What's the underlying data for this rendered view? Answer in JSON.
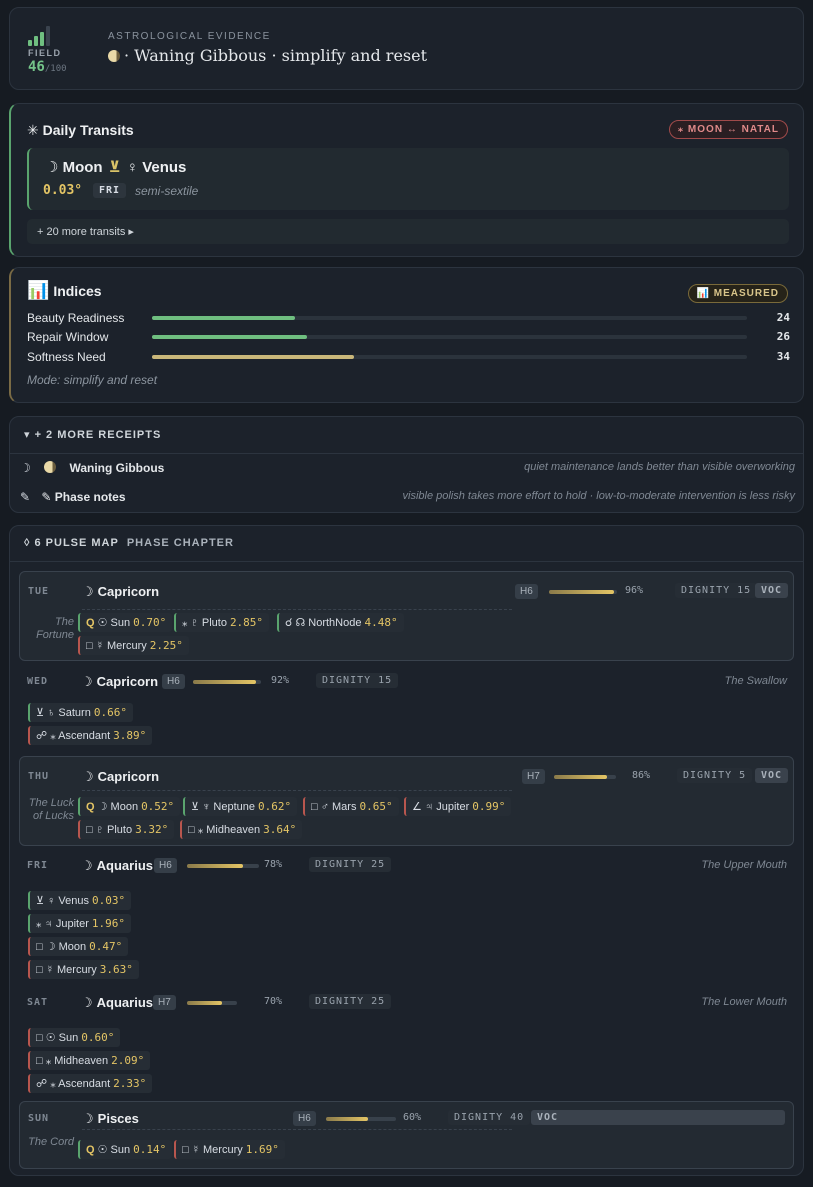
{
  "header": {
    "field_label": "FIELD",
    "field_value": "46",
    "field_max": "/100",
    "evidence_label": "ASTROLOGICAL EVIDENCE",
    "evidence_title": "· Waning Gibbous · simplify and reset"
  },
  "transits": {
    "title": "Daily Transits",
    "badge": "⁎ MOON ↔ NATAL",
    "main": {
      "body1": "☽ Moon",
      "aspect": "⊻",
      "body2": "♀ Venus",
      "orb": "0.03°",
      "day": "FRI",
      "desc": "semi-sextile"
    },
    "more": "+ 20 more transits ▸"
  },
  "indices": {
    "title": "Indices",
    "badge": "📊 MEASURED",
    "items": [
      {
        "label": "Beauty Readiness",
        "value": 24,
        "color": "#6fbf80"
      },
      {
        "label": "Repair Window",
        "value": 26,
        "color": "#6fbf80"
      },
      {
        "label": "Softness Need",
        "value": 34,
        "color": "#c9b77a"
      }
    ],
    "mode": "Mode: simplify and reset"
  },
  "receipts": {
    "title": "▾ + 2 MORE RECEIPTS",
    "rows": [
      {
        "icon": "☽",
        "label": "Waning Gibbous",
        "note": "quiet maintenance lands better than visible overworking"
      },
      {
        "icon": "✎",
        "label": "✎ Phase notes",
        "note": "visible polish takes more effort to hold · low-to-moderate intervention is less risky"
      }
    ]
  },
  "pulse": {
    "title": "◊ 6 PULSE MAP",
    "subtitle": "PHASE CHAPTER",
    "days": [
      {
        "day": "TUE",
        "sign": "Capricorn",
        "house": "H6",
        "pct": 96,
        "pct_label": "96%",
        "dignity": "DIGNITY 15",
        "voc": "VOC",
        "chapter": "The Fortune",
        "tags": [
          {
            "q": "Q",
            "text": "☉ Sun",
            "orb": "0.70°"
          },
          {
            "text": "⁎ ♇ Pluto",
            "orb": "2.85°"
          },
          {
            "text": "☌ ☊ NorthNode",
            "orb": "4.48°"
          },
          {
            "text": "□ ☿ Mercury",
            "orb": "2.25°"
          }
        ]
      },
      {
        "day": "WED",
        "sign": "Capricorn",
        "house": "H6",
        "pct": 92,
        "pct_label": "92%",
        "dignity": "DIGNITY 15",
        "chapter": "The Swallow",
        "tags": [
          {
            "text": "⊻ ♄ Saturn",
            "orb": "0.66°"
          },
          {
            "text": "☍ ⁎ Ascendant",
            "orb": "3.89°"
          }
        ]
      },
      {
        "day": "THU",
        "sign": "Capricorn",
        "house": "H7",
        "pct": 86,
        "pct_label": "86%",
        "dignity": "DIGNITY 5",
        "voc": "VOC",
        "chapter": "The Luck of Lucks",
        "tags": [
          {
            "q": "Q",
            "text": "☽ Moon",
            "orb": "0.52°"
          },
          {
            "text": "⊻ ♆ Neptune",
            "orb": "0.62°"
          },
          {
            "text": "□ ♂ Mars",
            "orb": "0.65°"
          },
          {
            "text": "∠ ♃ Jupiter",
            "orb": "0.99°"
          },
          {
            "text": "□ ♇ Pluto",
            "orb": "3.32°"
          },
          {
            "text": "□ ⁎ Midheaven",
            "orb": "3.64°"
          }
        ]
      },
      {
        "day": "FRI",
        "sign": "Aquarius",
        "house": "H6",
        "pct": 78,
        "pct_label": "78%",
        "dignity": "DIGNITY 25",
        "chapter": "The Upper Mouth",
        "tags": [
          {
            "text": "⊻ ♀ Venus",
            "orb": "0.03°"
          },
          {
            "text": "⁎ ♃ Jupiter",
            "orb": "1.96°"
          },
          {
            "text": "□ ☽ Moon",
            "orb": "0.47°"
          },
          {
            "text": "□ ☿ Mercury",
            "orb": "3.63°"
          }
        ]
      },
      {
        "day": "SAT",
        "sign": "Aquarius",
        "house": "H7",
        "pct": 70,
        "pct_label": "70%",
        "dignity": "DIGNITY 25",
        "chapter": "The Lower Mouth",
        "tags": [
          {
            "text": "□ ☉ Sun",
            "orb": "0.60°"
          },
          {
            "text": "□ ⁎ Midheaven",
            "orb": "2.09°"
          },
          {
            "text": "☍ ⁎ Ascendant",
            "orb": "2.33°"
          }
        ]
      },
      {
        "day": "SUN",
        "sign": "Pisces",
        "house": "H6",
        "pct": 60,
        "pct_label": "60%",
        "dignity": "DIGNITY 40",
        "voc": "VOC",
        "chapter": "The Cord",
        "tags": [
          {
            "q": "Q",
            "text": "☉ Sun",
            "orb": "0.14°"
          },
          {
            "text": "□ ☿ Mercury",
            "orb": "1.69°"
          }
        ]
      }
    ]
  }
}
